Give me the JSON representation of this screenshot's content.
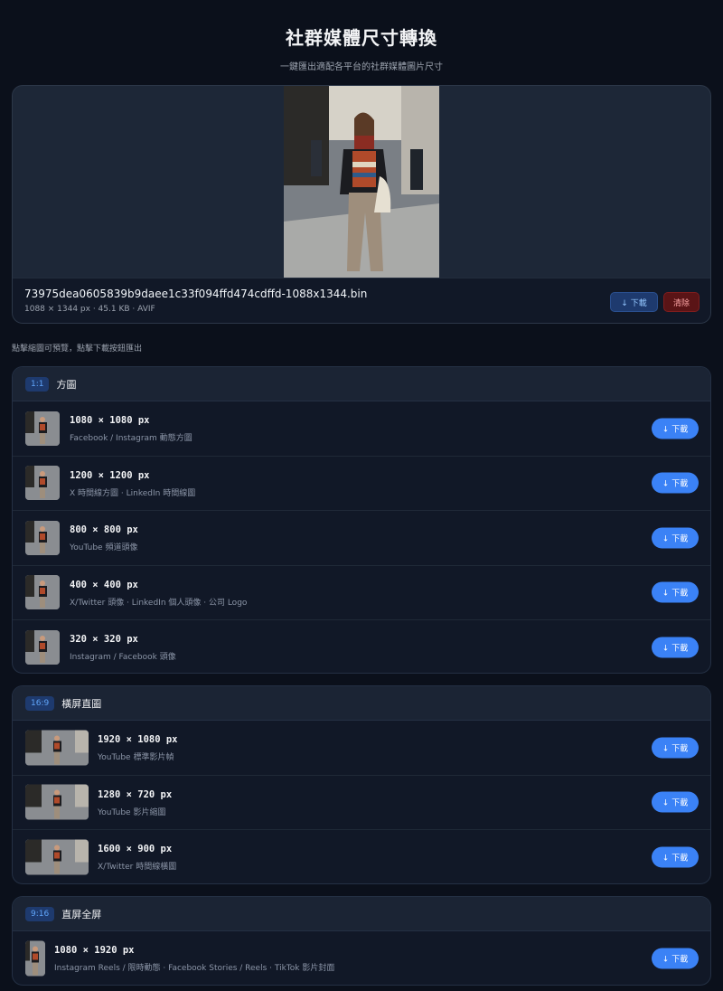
{
  "header": {
    "title": "社群媒體尺寸轉換",
    "subtitle": "一鍵匯出適配各平台的社群媒體圖片尺寸"
  },
  "file": {
    "name": "73975dea0605839b9daee1c33f094ffd474cdffd-1088x1344.bin",
    "meta": "1088 × 1344 px · 45.1 KB · AVIF",
    "download_label": "↓ 下載",
    "clear_label": "清除"
  },
  "hint": "點擊縮圖可預覽，點擊下載按鈕匯出",
  "download_label": "↓ 下載",
  "groups": [
    {
      "ratio": "1:1",
      "title": "方圖",
      "items": [
        {
          "size": "1080 × 1080 px",
          "desc": "Facebook / Instagram 動態方圖"
        },
        {
          "size": "1200 × 1200 px",
          "desc": "X 時間線方圖 · LinkedIn 時間線圖"
        },
        {
          "size": "800 × 800 px",
          "desc": "YouTube 頻道頭像"
        },
        {
          "size": "400 × 400 px",
          "desc": "X/Twitter 頭像 · LinkedIn 個人頭像 · 公司 Logo"
        },
        {
          "size": "320 × 320 px",
          "desc": "Instagram / Facebook 頭像"
        }
      ]
    },
    {
      "ratio": "16:9",
      "title": "橫屏直圖",
      "items": [
        {
          "size": "1920 × 1080 px",
          "desc": "YouTube 標準影片幀"
        },
        {
          "size": "1280 × 720 px",
          "desc": "YouTube 影片縮圖"
        },
        {
          "size": "1600 × 900 px",
          "desc": "X/Twitter 時間線橫圖"
        }
      ]
    },
    {
      "ratio": "9:16",
      "title": "直屏全屏",
      "items": [
        {
          "size": "1080 × 1920 px",
          "desc": "Instagram Reels / 限時動態 · Facebook Stories / Reels · TikTok 影片封面"
        }
      ]
    }
  ]
}
